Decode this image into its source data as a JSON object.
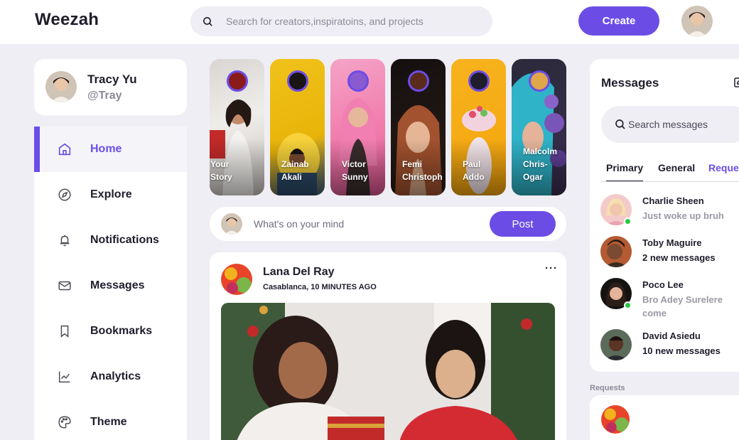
{
  "app": {
    "logo": "Weezah"
  },
  "header": {
    "search_placeholder": "Search for creators,inspiratoins, and projects",
    "create_label": "Create"
  },
  "profile": {
    "name": "Tracy Yu",
    "handle": "@Tray"
  },
  "sidebar": {
    "items": [
      {
        "label": "Home",
        "icon": "home-icon",
        "active": true
      },
      {
        "label": "Explore",
        "icon": "compass-icon"
      },
      {
        "label": "Notifications",
        "icon": "bell-icon"
      },
      {
        "label": "Messages",
        "icon": "envelope-icon"
      },
      {
        "label": "Bookmarks",
        "icon": "bookmark-icon"
      },
      {
        "label": "Analytics",
        "icon": "chart-line-icon"
      },
      {
        "label": "Theme",
        "icon": "palette-icon"
      }
    ]
  },
  "stories": [
    {
      "line1": "Your",
      "line2": "Story",
      "line3": ""
    },
    {
      "line1": "Zainab",
      "line2": "Akali",
      "line3": ""
    },
    {
      "line1": "Victor",
      "line2": "Sunny",
      "line3": ""
    },
    {
      "line1": "Femi",
      "line2": "Christoph",
      "line3": ""
    },
    {
      "line1": "Paul",
      "line2": "Addo",
      "line3": ""
    },
    {
      "line1": "Malcolm",
      "line2": "Chris-",
      "line3": "Ogar"
    }
  ],
  "composer": {
    "placeholder": "What's on your mind",
    "post_label": "Post"
  },
  "feed": {
    "author": "Lana Del Ray",
    "meta": "Casablanca, 10 MINUTES AGO",
    "more": "···"
  },
  "messages": {
    "title": "Messages",
    "search_placeholder": "Search messages",
    "tabs": [
      "Primary",
      "General",
      "Reque"
    ],
    "items": [
      {
        "name": "Charlie Sheen",
        "text": "Just woke up bruh",
        "read": true,
        "online": true
      },
      {
        "name": "Toby Maguire",
        "text": "2 new messages",
        "read": false,
        "online": false
      },
      {
        "name": "Poco Lee",
        "text": "Bro Adey Surelere come",
        "read": true,
        "online": true
      },
      {
        "name": "David Asiedu",
        "text": "10 new messages",
        "read": false,
        "online": false
      }
    ],
    "requests_label": "Requests"
  },
  "colors": {
    "accent": "#6b4de6",
    "background": "#efeef4",
    "online": "#27c93f"
  }
}
